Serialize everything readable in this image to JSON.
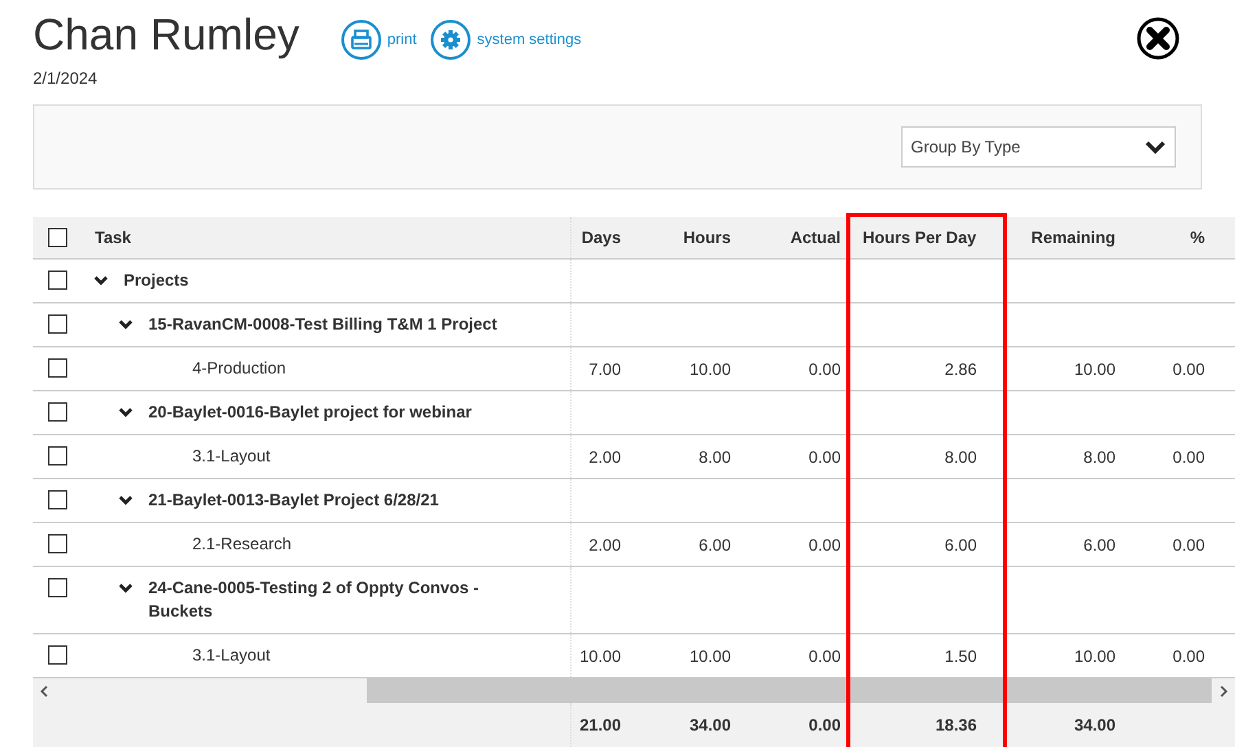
{
  "header": {
    "title": "Chan Rumley",
    "date": "2/1/2024",
    "actions": [
      {
        "kind": "print",
        "label": "print"
      },
      {
        "kind": "settings",
        "label": "system settings"
      }
    ]
  },
  "toolbar": {
    "group_by": {
      "value": "Group By Type"
    }
  },
  "table": {
    "select_all": {
      "checked": false
    },
    "columns": [
      {
        "label": "Task",
        "highlighted": false
      },
      {
        "label": "Days",
        "highlighted": false
      },
      {
        "label": "Hours",
        "highlighted": false
      },
      {
        "label": "Actual",
        "highlighted": false
      },
      {
        "label": "Hours Per Day",
        "highlighted": true
      },
      {
        "label": "Remaining",
        "highlighted": false
      },
      {
        "label": "%",
        "highlighted": false
      }
    ],
    "rows": [
      {
        "kind": "group",
        "label": "Projects",
        "checked": false,
        "expanded": true,
        "children": [
          {
            "kind": "group",
            "label": "15-RavanCM-0008-Test Billing T&M 1 Project",
            "checked": false,
            "expanded": true,
            "children": [
              {
                "kind": "task",
                "label": "4-Production",
                "checked": false,
                "values": [
                  "7.00",
                  "10.00",
                  "0.00",
                  "2.86",
                  "10.00",
                  "0.00"
                ]
              }
            ]
          },
          {
            "kind": "group",
            "label": "20-Baylet-0016-Baylet project for webinar",
            "checked": false,
            "expanded": true,
            "children": [
              {
                "kind": "task",
                "label": "3.1-Layout",
                "checked": false,
                "values": [
                  "2.00",
                  "8.00",
                  "0.00",
                  "8.00",
                  "8.00",
                  "0.00"
                ]
              }
            ]
          },
          {
            "kind": "group",
            "label": "21-Baylet-0013-Baylet Project 6/28/21",
            "checked": false,
            "expanded": true,
            "children": [
              {
                "kind": "task",
                "label": "2.1-Research",
                "checked": false,
                "values": [
                  "2.00",
                  "6.00",
                  "0.00",
                  "6.00",
                  "6.00",
                  "0.00"
                ]
              }
            ]
          },
          {
            "kind": "group",
            "label": "24-Cane-0005-Testing 2 of Oppty Convos - Buckets",
            "checked": false,
            "expanded": true,
            "children": [
              {
                "kind": "task",
                "label": "3.1-Layout",
                "checked": false,
                "values": [
                  "10.00",
                  "10.00",
                  "0.00",
                  "1.50",
                  "10.00",
                  "0.00"
                ]
              }
            ]
          }
        ]
      }
    ],
    "totals": [
      "21.00",
      "34.00",
      "0.00",
      "18.36",
      "34.00"
    ]
  }
}
